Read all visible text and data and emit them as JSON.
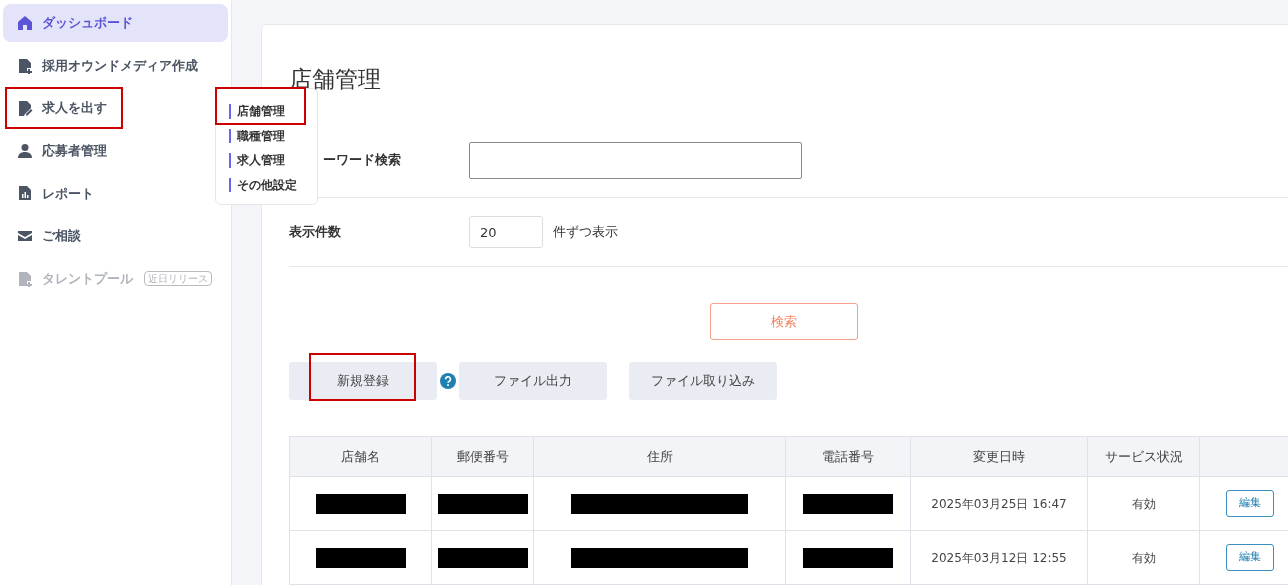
{
  "sidebar": {
    "items": [
      {
        "label": "ダッシュボード",
        "selected": true,
        "disabled": false,
        "highlighted": false
      },
      {
        "label": "採用オウンドメディア作成",
        "selected": false,
        "disabled": false,
        "highlighted": false
      },
      {
        "label": "求人を出す",
        "selected": false,
        "disabled": false,
        "highlighted": true
      },
      {
        "label": "応募者管理",
        "selected": false,
        "disabled": false,
        "highlighted": false
      },
      {
        "label": "レポート",
        "selected": false,
        "disabled": false,
        "highlighted": false
      },
      {
        "label": "ご相談",
        "selected": false,
        "disabled": false,
        "highlighted": false
      },
      {
        "label": "タレントプール",
        "selected": false,
        "disabled": true,
        "highlighted": false,
        "badge": "近日リリース"
      }
    ]
  },
  "submenu": {
    "items": [
      {
        "label": "店舗管理",
        "highlighted": true
      },
      {
        "label": "職種管理",
        "highlighted": false
      },
      {
        "label": "求人管理",
        "highlighted": false
      },
      {
        "label": "その他設定",
        "highlighted": false
      }
    ]
  },
  "page_title": "店舗管理",
  "keyword": {
    "label": "ーワード検索"
  },
  "page_size": {
    "label": "表示件数",
    "value": "20",
    "suffix": "件ずつ表示"
  },
  "search_button": "検索",
  "actions": [
    {
      "label": "新規登録",
      "highlighted": true,
      "help": true
    },
    {
      "label": "ファイル出力",
      "highlighted": false,
      "help": false
    },
    {
      "label": "ファイル取り込み",
      "highlighted": false,
      "help": false
    }
  ],
  "table": {
    "columns": [
      "店舗名",
      "郵便番号",
      "住所",
      "電話番号",
      "変更日時",
      "サービス状況",
      ""
    ],
    "rows": [
      {
        "cells": [
          {
            "kind": "redacted"
          },
          {
            "kind": "redacted"
          },
          {
            "kind": "redacted"
          },
          {
            "kind": "redacted"
          },
          {
            "kind": "text",
            "text": "2025年03月25日 16:47"
          },
          {
            "kind": "text",
            "text": "有効"
          },
          {
            "kind": "button",
            "text": "編集"
          }
        ]
      },
      {
        "cells": [
          {
            "kind": "redacted"
          },
          {
            "kind": "redacted"
          },
          {
            "kind": "redacted"
          },
          {
            "kind": "redacted"
          },
          {
            "kind": "text",
            "text": "2025年03月12日 12:55"
          },
          {
            "kind": "text",
            "text": "有効"
          },
          {
            "kind": "button",
            "text": "編集"
          }
        ]
      }
    ]
  }
}
